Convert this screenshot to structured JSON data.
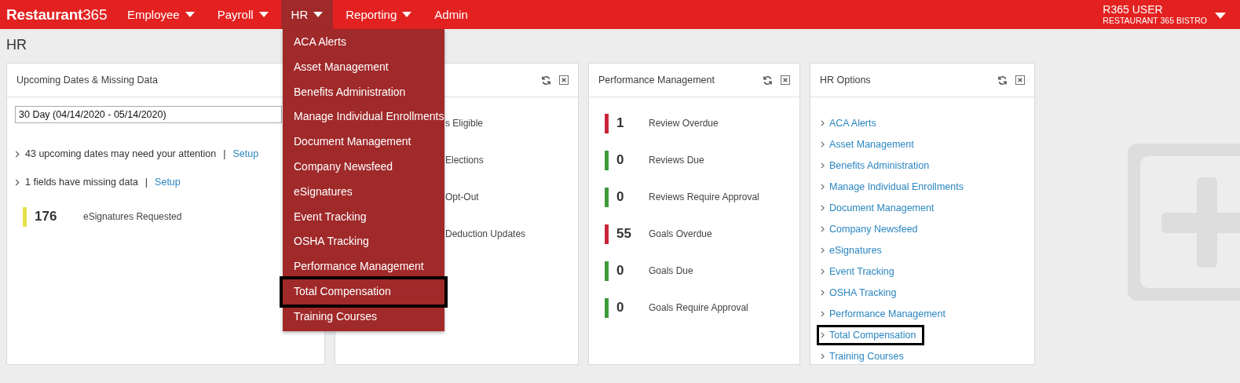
{
  "topbar": {
    "logo": "**Restaurant**365",
    "nav": [
      {
        "label": "Employee",
        "has_menu": true,
        "selected": false
      },
      {
        "label": "Payroll",
        "has_menu": true,
        "selected": false
      },
      {
        "label": "HR",
        "has_menu": true,
        "selected": true
      },
      {
        "label": "Reporting",
        "has_menu": true,
        "selected": false
      },
      {
        "label": "Admin",
        "has_menu": false,
        "selected": false
      }
    ],
    "user": {
      "name": "R365 USER",
      "company": "RESTAURANT 365 BISTRO"
    }
  },
  "page_title": "HR",
  "panels": [
    {
      "kind": "upcoming",
      "header_icons": false,
      "title": "Upcoming Dates & Missing Data",
      "date_select": "30 Day (04/14/2020 - 05/14/2020)",
      "notices": [
        {
          "text": "43 upcoming dates may need your attention",
          "separator": "|",
          "link": "Setup"
        },
        {
          "text": "1 fields have missing data",
          "separator": "|",
          "link": "Setup"
        }
      ],
      "metrics": [
        {
          "value": "176",
          "label": "eSignatures Requested",
          "color": "#e8e04a"
        }
      ]
    },
    {
      "kind": "metrics",
      "header_icons": true,
      "metrics": [
        {
          "label": "s Eligible"
        },
        {
          "label": "Elections"
        },
        {
          "label": "Opt-Out"
        },
        {
          "label": "Deduction Updates"
        }
      ]
    },
    {
      "kind": "metrics",
      "header_icons": true,
      "title": "Performance Management",
      "metrics": [
        {
          "value": "1",
          "label": "Review Overdue",
          "color": "#c8253a"
        },
        {
          "value": "0",
          "label": "Reviews Due",
          "color": "#3e9a3a"
        },
        {
          "value": "0",
          "label": "Reviews Require Approval",
          "color": "#3e9a3a"
        },
        {
          "value": "55",
          "label": "Goals Overdue",
          "color": "#c8253a"
        },
        {
          "value": "0",
          "label": "Goals Due",
          "color": "#3e9a3a"
        },
        {
          "value": "0",
          "label": "Goals Require Approval",
          "color": "#3e9a3a"
        }
      ]
    },
    {
      "kind": "links",
      "header_icons": true,
      "title": "HR Options",
      "links": [
        {
          "label": "ACA Alerts",
          "outlined": false
        },
        {
          "label": "Asset Management",
          "outlined": false
        },
        {
          "label": "Benefits Administration",
          "outlined": false
        },
        {
          "label": "Manage Individual Enrollments",
          "outlined": false
        },
        {
          "label": "Document Management",
          "outlined": false
        },
        {
          "label": "Company Newsfeed",
          "outlined": false
        },
        {
          "label": "eSignatures",
          "outlined": false
        },
        {
          "label": "Event Tracking",
          "outlined": false
        },
        {
          "label": "OSHA Tracking",
          "outlined": false
        },
        {
          "label": "Performance Management",
          "outlined": false
        },
        {
          "label": "Total Compensation",
          "outlined": true
        },
        {
          "label": "Training Courses",
          "outlined": false
        }
      ]
    }
  ],
  "hr_menu": {
    "items": [
      {
        "label": "ACA Alerts",
        "outlined": false
      },
      {
        "label": "Asset Management",
        "outlined": false
      },
      {
        "label": "Benefits Administration",
        "outlined": false
      },
      {
        "label": "Manage Individual Enrollments",
        "outlined": false
      },
      {
        "label": "Document Management",
        "outlined": false
      },
      {
        "label": "Company Newsfeed",
        "outlined": false
      },
      {
        "label": "eSignatures",
        "outlined": false
      },
      {
        "label": "Event Tracking",
        "outlined": false
      },
      {
        "label": "OSHA Tracking",
        "outlined": false
      },
      {
        "label": "Performance Management",
        "outlined": false
      },
      {
        "label": "Total Compensation",
        "outlined": true
      },
      {
        "label": "Training Courses",
        "outlined": false
      }
    ]
  }
}
